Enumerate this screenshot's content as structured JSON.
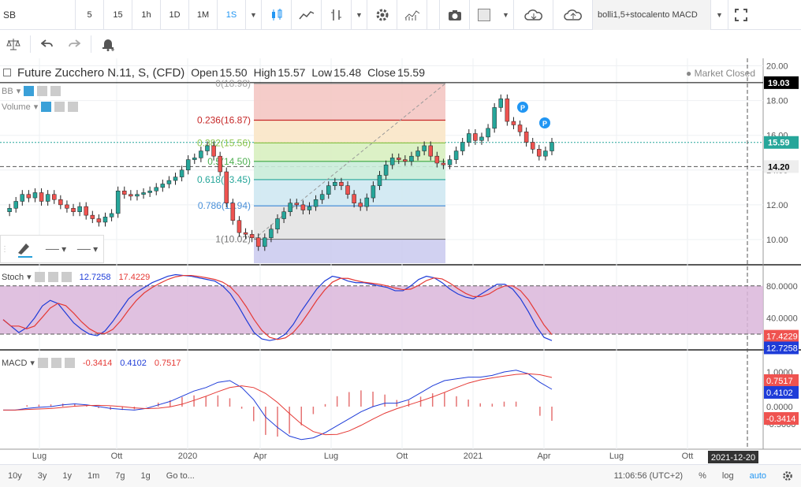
{
  "toolbar": {
    "symbol": "SB",
    "timeframes": [
      "5",
      "15",
      "1h",
      "1D",
      "1M",
      "1S"
    ],
    "active_timeframe": "1S",
    "study_template": "bolli1,5+stocalento MACD"
  },
  "chart": {
    "title": "Future Zucchero N.11, S, (CFD)",
    "ohlc": {
      "open_label": "Open",
      "open": "15.50",
      "high_label": "High",
      "high": "15.57",
      "low_label": "Low",
      "low": "15.48",
      "close_label": "Close",
      "close": "15.59"
    },
    "market_status": "Market Closed",
    "indicators_main": [
      "BB",
      "Volume"
    ],
    "price_axis": [
      "20.00",
      "18.00",
      "16.00",
      "14.00",
      "12.00",
      "10.00"
    ],
    "price_tags": [
      {
        "label": "19.03",
        "color": "#000000",
        "price": 19.03
      },
      {
        "label": "15.59",
        "color": "#26a69a",
        "price": 15.59
      },
      {
        "label": "14.20",
        "color": "#555555",
        "price": 14.2
      }
    ],
    "fib_levels": [
      {
        "label": "0(18.98)",
        "price": 18.98,
        "color": "#9e9e9e",
        "fill": "#f4c7c3"
      },
      {
        "label": "0.236(16.87)",
        "price": 16.87,
        "color": "#c62828",
        "fill": "#f9e5c7"
      },
      {
        "label": "0.382(15.56)",
        "price": 15.56,
        "color": "#8bc34a",
        "fill": "#d8efc0"
      },
      {
        "label": "0.5(14.50)",
        "price": 14.5,
        "color": "#4caf50",
        "fill": "#c9ecd9"
      },
      {
        "label": "0.618(13.45)",
        "price": 13.45,
        "color": "#26a69a",
        "fill": "#cfe8f2"
      },
      {
        "label": "0.786(11.94)",
        "price": 11.94,
        "color": "#4a90d9",
        "fill": "#e3e3e3"
      },
      {
        "label": "1(10.02)",
        "price": 10.02,
        "color": "#757575",
        "fill": "#ccccf0"
      }
    ],
    "x_axis": [
      "Lug",
      "Ott",
      "2020",
      "Apr",
      "Lug",
      "Ott",
      "2021",
      "Apr",
      "Lug",
      "Ott"
    ],
    "date_tag": "2021-12-20"
  },
  "stoch": {
    "name": "Stoch",
    "k": "12.7258",
    "d": "17.4229",
    "axis": [
      "80.0000",
      "40.0000"
    ],
    "tag_d": "17.4229",
    "tag_k": "12.7258"
  },
  "macd": {
    "name": "MACD",
    "hist": "-0.3414",
    "macd": "0.4102",
    "signal": "0.7517",
    "axis": [
      "1.0000",
      "0.5000",
      "0.0000",
      "-0.5000"
    ],
    "tag_signal": "0.7517",
    "tag_macd": "0.4102",
    "tag_hist": "-0.3414"
  },
  "bottom": {
    "ranges": [
      "10y",
      "3y",
      "1y",
      "1m",
      "7g",
      "1g"
    ],
    "goto": "Go to...",
    "time": "11:06:56 (UTC+2)",
    "percent": "%",
    "log": "log",
    "auto": "auto"
  },
  "colors": {
    "up": "#26a69a",
    "down": "#ef5350",
    "stoch_k": "#1e3cd8",
    "stoch_d": "#e53935",
    "stoch_band": "#dab6db"
  }
}
